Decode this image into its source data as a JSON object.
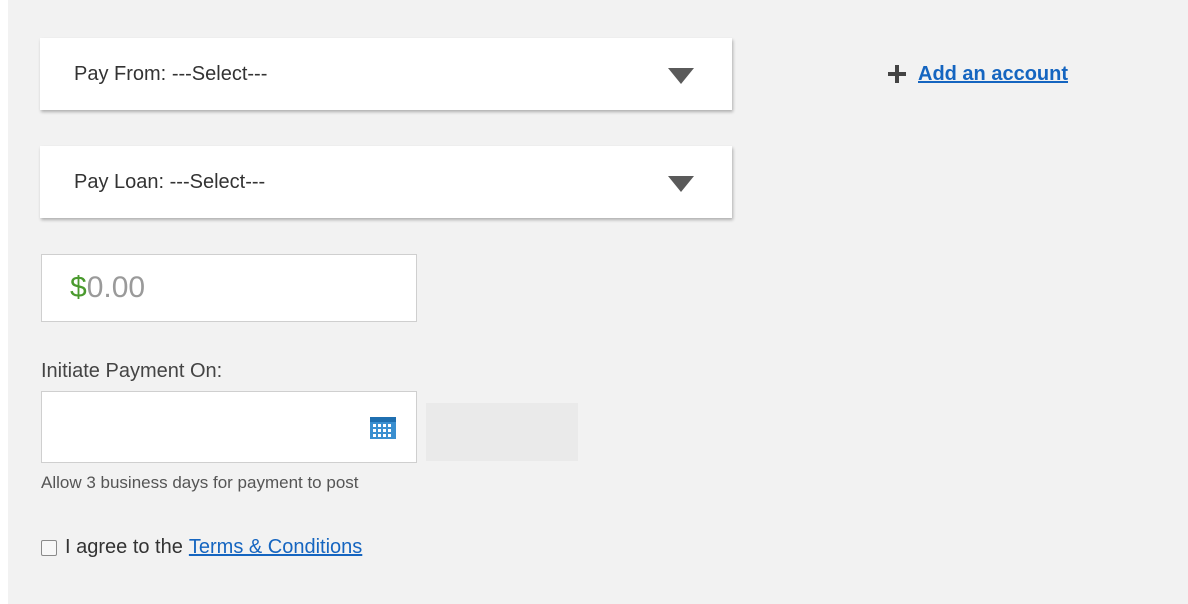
{
  "pay_from": {
    "label": "Pay From:",
    "selected": "---Select---"
  },
  "pay_loan": {
    "label": "Pay Loan:",
    "selected": "---Select---"
  },
  "add_account": {
    "label": "Add an account"
  },
  "amount": {
    "currency_symbol": "$",
    "placeholder": "0.00"
  },
  "payment_date": {
    "label": "Initiate Payment On:",
    "value": "",
    "hint": "Allow 3 business days for payment to post"
  },
  "terms": {
    "prefix": "I agree to the",
    "link_label": "Terms & Conditions",
    "checked": false
  },
  "colors": {
    "link": "#1565c0",
    "currency": "#4a9a2e",
    "panel_bg": "#f2f2f2",
    "calendar_icon": "#3a8fd0"
  },
  "icons": {
    "add": "plus-icon",
    "dropdown": "chevron-down-icon",
    "date_picker": "calendar-icon"
  }
}
